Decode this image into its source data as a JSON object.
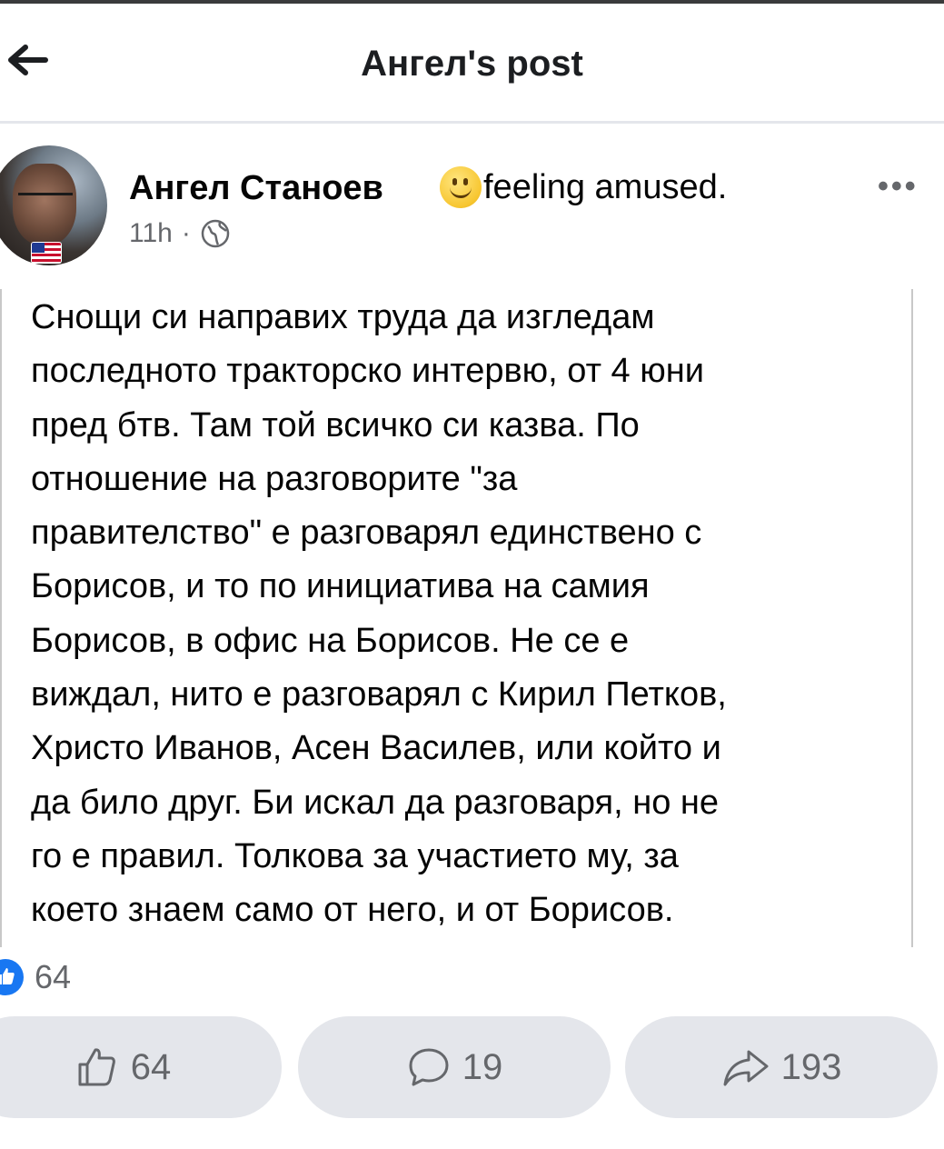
{
  "header": {
    "title": "Ангел's post"
  },
  "post": {
    "author": "Ангел Станоев",
    "feeling": "feeling amused.",
    "time": "11h",
    "separator": "·",
    "text": "Снощи си направих труда да изгледам\nпоследното тракторско интервю, от 4 юни\nпред бтв. Там той всичко си казва. По\nотношение на разговорите \"за\nправителство\" е разговарял единствено с\nБорисов, и то по инициатива на самия\nБорисов, в офис на Борисов. Не се е\nвиждал, нито е разговарял с Кирил Петков,\nХристо Иванов, Асен Василев, или който и\nда било друг. Би искал да разговаря, но не\nго е правил. Толкова за участието му, за\nкоето знаем само от него, и от Борисов.",
    "reaction_count": "64"
  },
  "actions": {
    "like": "64",
    "comment": "19",
    "share": "193"
  },
  "colors": {
    "accent": "#1877f2",
    "button_bg": "#e4e6eb",
    "muted_text": "#65676b"
  },
  "icons": [
    "back-arrow-icon",
    "feeling-smiley-icon",
    "more-icon",
    "globe-icon",
    "like-badge-icon",
    "like-icon",
    "comment-icon",
    "share-icon"
  ]
}
